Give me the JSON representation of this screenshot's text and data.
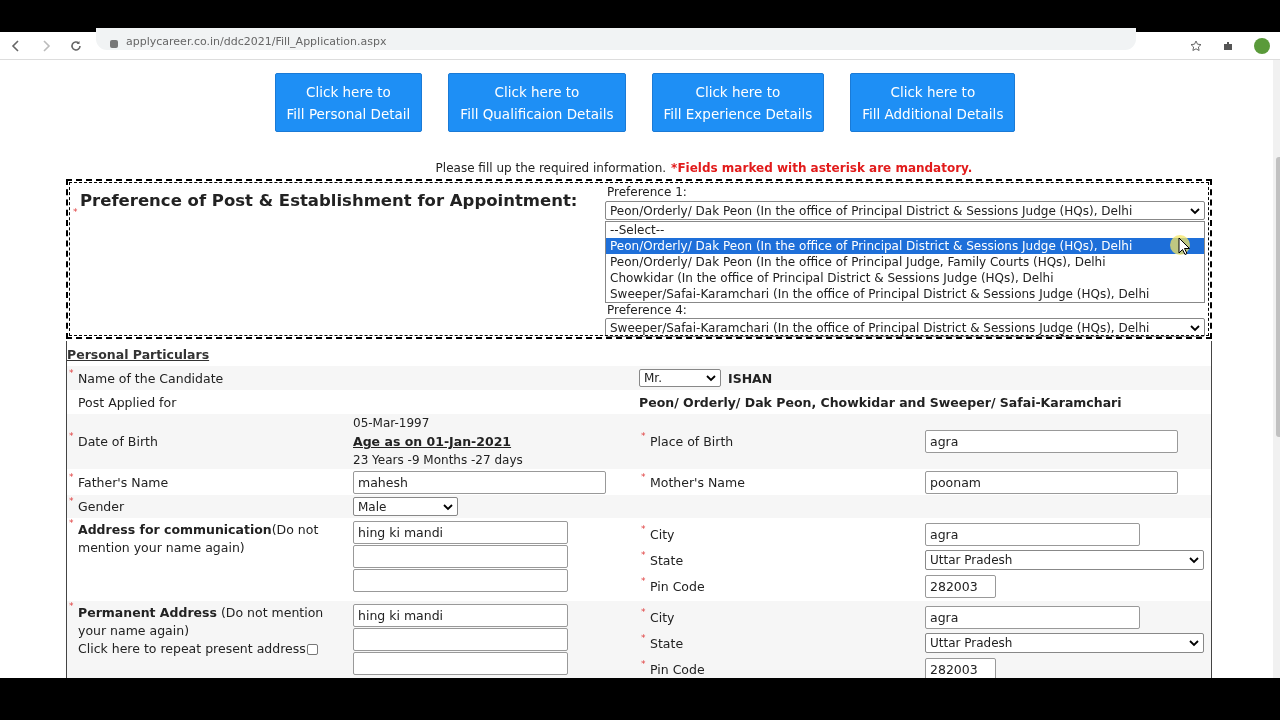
{
  "browser": {
    "url": "applycareer.co.in/ddc2021/Fill_Application.aspx"
  },
  "nav_buttons": [
    {
      "lines": [
        "Click here to",
        "Fill Personal Detail"
      ]
    },
    {
      "lines": [
        "Click here to",
        "Fill Qualificaion Details"
      ]
    },
    {
      "lines": [
        "Click here to",
        "Fill Experience Details"
      ]
    },
    {
      "lines": [
        "Click here to",
        "Fill Additional Details"
      ]
    }
  ],
  "notice": {
    "text": "Please fill up the required information.",
    "mandatory": "*Fields marked with asterisk are mandatory."
  },
  "preferences": {
    "title": "Preference of Post & Establishment for Appointment:",
    "asterisk": "*",
    "first": {
      "label": "Preference 1:",
      "value": "Peon/Orderly/ Dak Peon (In the office of Principal District & Sessions Judge (HQs), Delhi"
    },
    "dropdown": [
      {
        "text": "--Select--",
        "selected": false
      },
      {
        "text": "Peon/Orderly/ Dak Peon (In the office of Principal District & Sessions Judge (HQs), Delhi",
        "selected": true
      },
      {
        "text": "Peon/Orderly/ Dak Peon (In the office of Principal Judge, Family Courts (HQs), Delhi",
        "selected": false
      },
      {
        "text": "Chowkidar (In the office of Principal District & Sessions Judge (HQs), Delhi",
        "selected": false
      },
      {
        "text": "Sweeper/Safai-Karamchari (In the office of Principal District & Sessions Judge (HQs), Delhi",
        "selected": false
      }
    ],
    "last": {
      "label": "Preference 4:",
      "value": "Sweeper/Safai-Karamchari (In the office of Principal District & Sessions Judge (HQs), Delhi"
    }
  },
  "personal": {
    "title": "Personal Particulars",
    "rows": [
      {
        "kind": "name",
        "label": "Name of the Candidate",
        "asterisk": "*",
        "salutation": "Mr.",
        "name": "ISHAN"
      },
      {
        "kind": "post",
        "label": "Post Applied for",
        "value": "Peon/ Orderly/ Dak Peon, Chowkidar and Sweeper/ Safai-Karamchari"
      },
      {
        "kind": "dob",
        "label": "Date of Birth",
        "asterisk": "*",
        "date": "05-Mar-1997",
        "age_label": "Age as on 01-Jan-2021",
        "age": "23 Years -9 Months -27 days",
        "right": {
          "label": "Place of Birth",
          "asterisk": "*",
          "value": "agra"
        }
      },
      {
        "kind": "pair",
        "label": "Father's Name",
        "asterisk": "*",
        "value": "mahesh",
        "right": {
          "label": "Mother's Name",
          "asterisk": "*",
          "value": "poonam"
        }
      },
      {
        "kind": "select",
        "label": "Gender",
        "asterisk": "*",
        "value": "Male"
      },
      {
        "kind": "address",
        "label": "**Address for communication**(Do not mention your name again)",
        "asterisk": "*",
        "lines": [
          "hing ki mandi"
        ],
        "city": {
          "label": "City",
          "asterisk": "*",
          "value": "agra"
        },
        "state": {
          "label": "State",
          "asterisk": "*",
          "value": "Uttar Pradesh"
        },
        "pin": {
          "label": "Pin Code",
          "asterisk": "*",
          "value": "282003"
        }
      },
      {
        "kind": "address",
        "label": "**Permanent Address** (Do not mention your name again)",
        "asterisk": "*",
        "lines": [
          "hing ki mandi"
        ],
        "repeat": {
          "label": "Click here to repeat present address",
          "checked": false
        },
        "city": {
          "label": "City",
          "asterisk": "*",
          "value": "agra"
        },
        "state": {
          "label": "State",
          "asterisk": "*",
          "value": "Uttar Pradesh"
        },
        "pin": {
          "label": "Pin Code",
          "asterisk": "*",
          "value": "282003"
        }
      }
    ]
  }
}
